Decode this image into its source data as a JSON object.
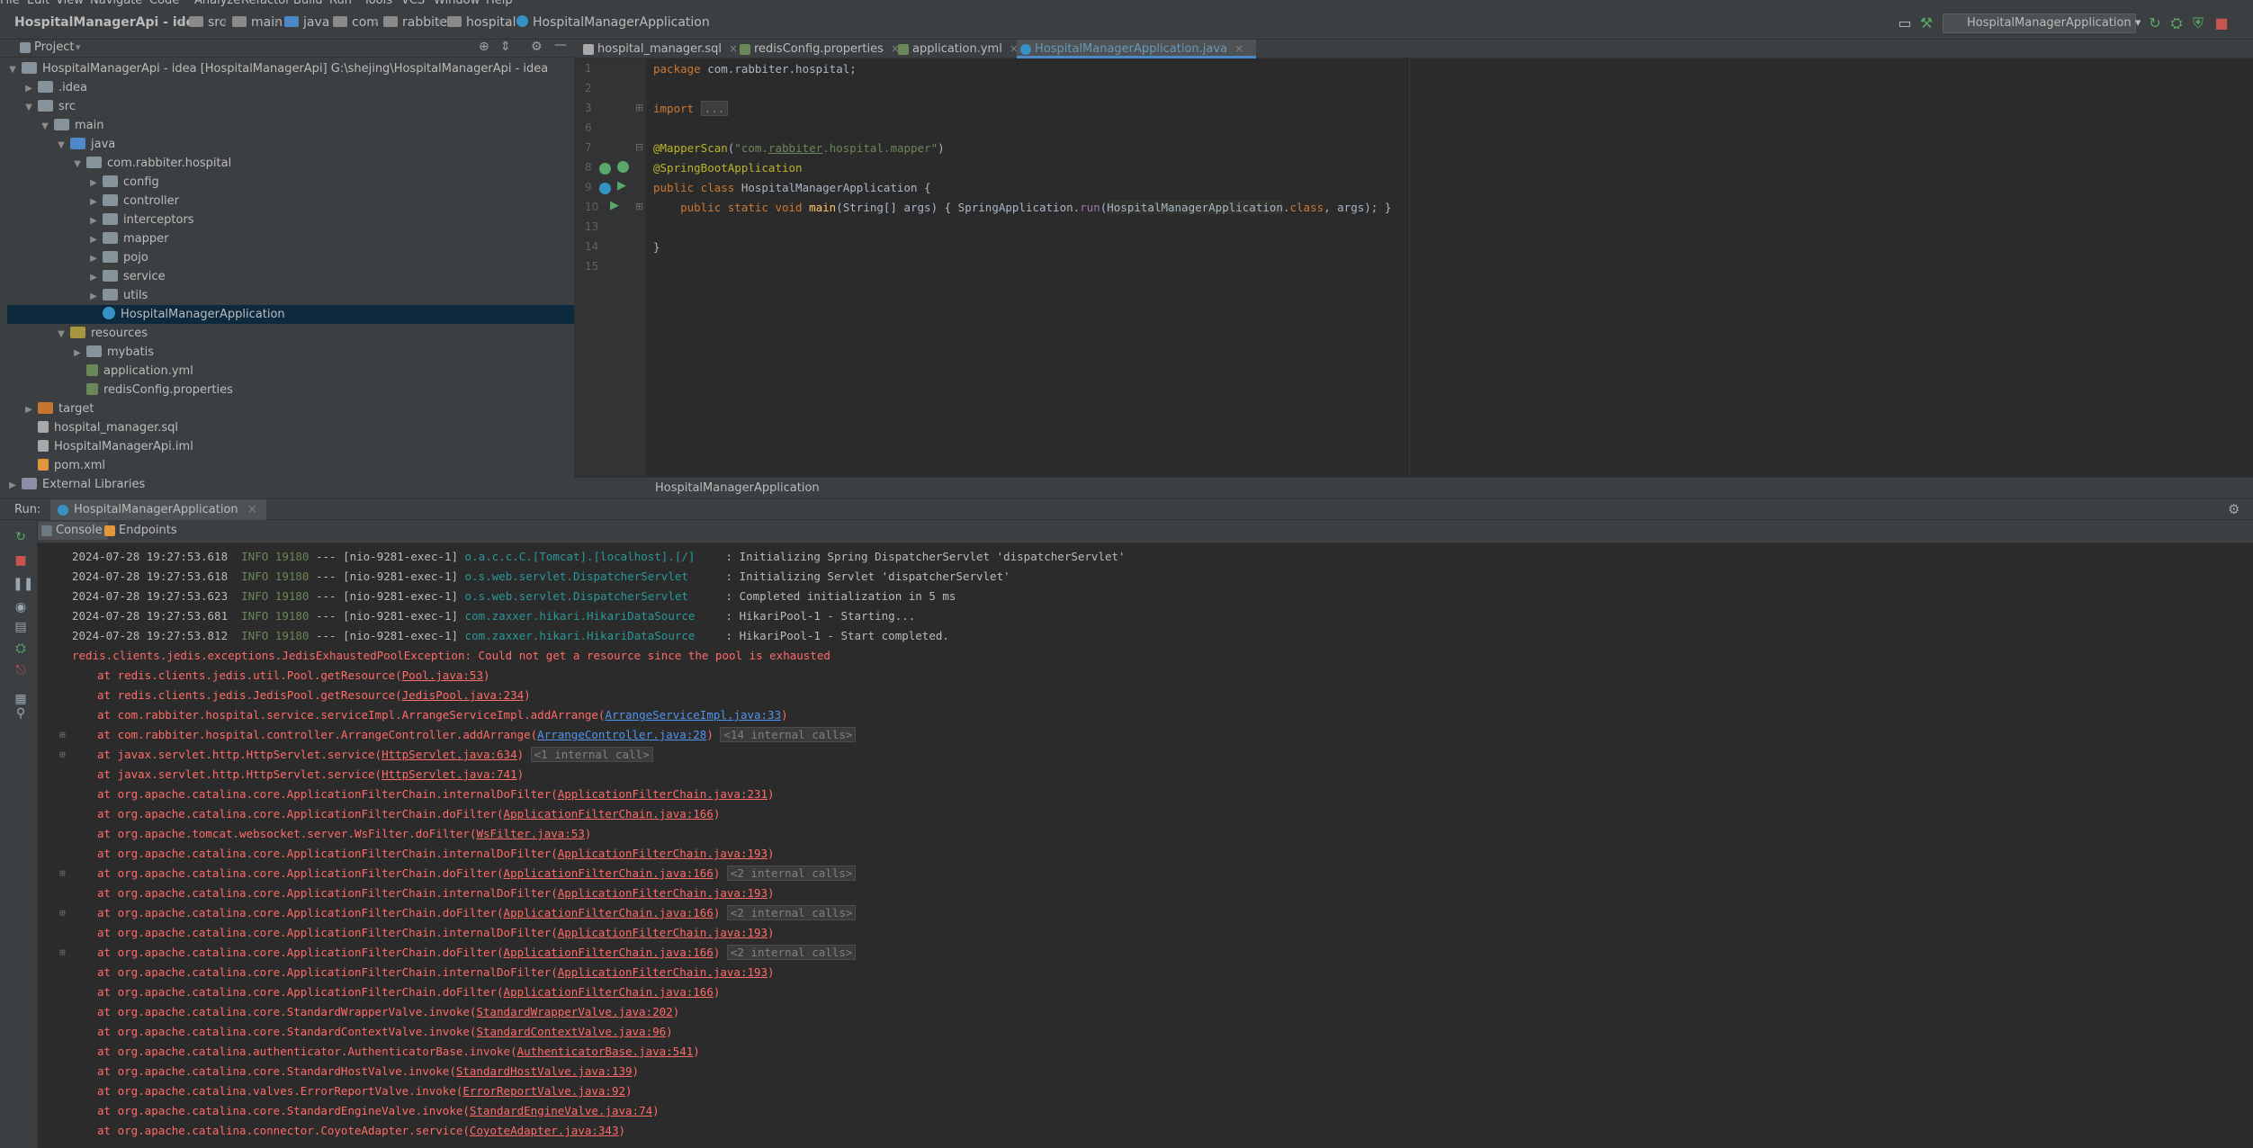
{
  "menu": [
    "File",
    "Edit",
    "View",
    "Navigate",
    "Code",
    "Analyze",
    "Refactor",
    "Build",
    "Run",
    "Tools",
    "VCS",
    "Window",
    "Help"
  ],
  "breadcrumbs": [
    "HospitalManagerApi - idea",
    "src",
    "main",
    "java",
    "com",
    "rabbiter",
    "hospital",
    "HospitalManagerApplication"
  ],
  "run_config": "HospitalManagerApplication",
  "project_panel": {
    "title": "Project",
    "tree": [
      {
        "label": "HospitalManagerApi - idea [HospitalManagerApi] G:\\shejing\\HospitalManagerApi - idea",
        "depth": 0,
        "expanded": true,
        "icon": "module"
      },
      {
        "label": ".idea",
        "depth": 1,
        "expanded": false,
        "icon": "folder"
      },
      {
        "label": "src",
        "depth": 1,
        "expanded": true,
        "icon": "folder"
      },
      {
        "label": "main",
        "depth": 2,
        "expanded": true,
        "icon": "folder"
      },
      {
        "label": "java",
        "depth": 3,
        "expanded": true,
        "icon": "src"
      },
      {
        "label": "com.rabbiter.hospital",
        "depth": 4,
        "expanded": true,
        "icon": "pkg"
      },
      {
        "label": "config",
        "depth": 5,
        "expanded": false,
        "icon": "pkg"
      },
      {
        "label": "controller",
        "depth": 5,
        "expanded": false,
        "icon": "pkg"
      },
      {
        "label": "interceptors",
        "depth": 5,
        "expanded": false,
        "icon": "pkg"
      },
      {
        "label": "mapper",
        "depth": 5,
        "expanded": false,
        "icon": "pkg"
      },
      {
        "label": "pojo",
        "depth": 5,
        "expanded": false,
        "icon": "pkg"
      },
      {
        "label": "service",
        "depth": 5,
        "expanded": false,
        "icon": "pkg"
      },
      {
        "label": "utils",
        "depth": 5,
        "expanded": false,
        "icon": "pkg"
      },
      {
        "label": "HospitalManagerApplication",
        "depth": 5,
        "expanded": null,
        "icon": "cls",
        "selected": true
      },
      {
        "label": "resources",
        "depth": 3,
        "expanded": true,
        "icon": "res"
      },
      {
        "label": "mybatis",
        "depth": 4,
        "expanded": false,
        "icon": "folder"
      },
      {
        "label": "application.yml",
        "depth": 4,
        "expanded": null,
        "icon": "file"
      },
      {
        "label": "redisConfig.properties",
        "depth": 4,
        "expanded": null,
        "icon": "file"
      },
      {
        "label": "target",
        "depth": 1,
        "expanded": false,
        "icon": "orange"
      },
      {
        "label": "hospital_manager.sql",
        "depth": 1,
        "expanded": null,
        "icon": "sql"
      },
      {
        "label": "HospitalManagerApi.iml",
        "depth": 1,
        "expanded": null,
        "icon": "sql"
      },
      {
        "label": "pom.xml",
        "depth": 1,
        "expanded": null,
        "icon": "xml"
      },
      {
        "label": "External Libraries",
        "depth": 0,
        "expanded": false,
        "icon": "lib"
      }
    ]
  },
  "editor": {
    "tabs": [
      {
        "label": "hospital_manager.sql",
        "active": false
      },
      {
        "label": "redisConfig.properties",
        "active": false
      },
      {
        "label": "application.yml",
        "active": false
      },
      {
        "label": "HospitalManagerApplication.java",
        "active": true
      }
    ],
    "line_numbers": [
      "1",
      "2",
      "3",
      "6",
      "7",
      "8",
      "9",
      "10",
      "13",
      "14",
      "15"
    ],
    "code": {
      "l1_kw": "package",
      "l1_rest": " com.rabbiter.hospital;",
      "l3_kw": "import",
      "l3_fold": "...",
      "l7_ann": "@MapperScan",
      "l7_a": "(",
      "l7_str1": "\"com.",
      "l7_str2": "rabbiter",
      "l7_str3": ".hospital.mapper\"",
      "l7_b": ")",
      "l8_ann": "@SpringBootApplication",
      "l9_kw": "public class",
      "l9_name": " HospitalManagerApplication",
      "l9_rest": " {",
      "l10_kw": "    public static void",
      "l10_fn": " main",
      "l10_args": "(String[] args)",
      "l10_body1": " { SpringApplication.",
      "l10_call": "run",
      "l10_body2": "(",
      "l10_cls": "HospitalManagerApplication",
      "l10_body3": ".",
      "l10_kw2": "class",
      "l10_body4": ", args); }",
      "l14": "}"
    },
    "breadcrumb": "HospitalManagerApplication"
  },
  "run_panel": {
    "label": "Run:",
    "tab": "HospitalManagerApplication",
    "subtabs": [
      "Console",
      "Endpoints"
    ],
    "log_info": [
      {
        "ts": "2024-07-28 19:27:53.618",
        "lvl": "INFO",
        "pid": "19180",
        "thread": "--- [nio-9281-exec-1]",
        "logger": "o.a.c.c.C.[Tomcat].[localhost].[/]",
        "msg": ": Initializing Spring DispatcherServlet 'dispatcherServlet'"
      },
      {
        "ts": "2024-07-28 19:27:53.618",
        "lvl": "INFO",
        "pid": "19180",
        "thread": "--- [nio-9281-exec-1]",
        "logger": "o.s.web.servlet.DispatcherServlet",
        "msg": ": Initializing Servlet 'dispatcherServlet'"
      },
      {
        "ts": "2024-07-28 19:27:53.623",
        "lvl": "INFO",
        "pid": "19180",
        "thread": "--- [nio-9281-exec-1]",
        "logger": "o.s.web.servlet.DispatcherServlet",
        "msg": ": Completed initialization in 5 ms"
      },
      {
        "ts": "2024-07-28 19:27:53.681",
        "lvl": "INFO",
        "pid": "19180",
        "thread": "--- [nio-9281-exec-1]",
        "logger": "com.zaxxer.hikari.HikariDataSource",
        "msg": ": HikariPool-1 - Starting..."
      },
      {
        "ts": "2024-07-28 19:27:53.812",
        "lvl": "INFO",
        "pid": "19180",
        "thread": "--- [nio-9281-exec-1]",
        "logger": "com.zaxxer.hikari.HikariDataSource",
        "msg": ": HikariPool-1 - Start completed."
      }
    ],
    "exception": "redis.clients.jedis.exceptions.JedisExhaustedPoolException: Could not get a resource since the pool is exhausted",
    "stack": [
      {
        "text": "at redis.clients.jedis.util.Pool.getResource(",
        "link": "Pool.java:53",
        "hint": "",
        "fold": false,
        "blue": false
      },
      {
        "text": "at redis.clients.jedis.JedisPool.getResource(",
        "link": "JedisPool.java:234",
        "hint": "",
        "fold": false,
        "blue": false
      },
      {
        "text": "at com.rabbiter.hospital.service.serviceImpl.ArrangeServiceImpl.addArrange(",
        "link": "ArrangeServiceImpl.java:33",
        "hint": "",
        "fold": false,
        "blue": true
      },
      {
        "text": "at com.rabbiter.hospital.controller.ArrangeController.addArrange(",
        "link": "ArrangeController.java:28",
        "hint": "<14 internal calls>",
        "fold": true,
        "blue": true
      },
      {
        "text": "at javax.servlet.http.HttpServlet.service(",
        "link": "HttpServlet.java:634",
        "hint": "<1 internal call>",
        "fold": true,
        "blue": false
      },
      {
        "text": "at javax.servlet.http.HttpServlet.service(",
        "link": "HttpServlet.java:741",
        "hint": "",
        "fold": false,
        "blue": false
      },
      {
        "text": "at org.apache.catalina.core.ApplicationFilterChain.internalDoFilter(",
        "link": "ApplicationFilterChain.java:231",
        "hint": "",
        "fold": false,
        "blue": false
      },
      {
        "text": "at org.apache.catalina.core.ApplicationFilterChain.doFilter(",
        "link": "ApplicationFilterChain.java:166",
        "hint": "",
        "fold": false,
        "blue": false
      },
      {
        "text": "at org.apache.tomcat.websocket.server.WsFilter.doFilter(",
        "link": "WsFilter.java:53",
        "hint": "",
        "fold": false,
        "blue": false
      },
      {
        "text": "at org.apache.catalina.core.ApplicationFilterChain.internalDoFilter(",
        "link": "ApplicationFilterChain.java:193",
        "hint": "",
        "fold": false,
        "blue": false
      },
      {
        "text": "at org.apache.catalina.core.ApplicationFilterChain.doFilter(",
        "link": "ApplicationFilterChain.java:166",
        "hint": "<2 internal calls>",
        "fold": true,
        "blue": false
      },
      {
        "text": "at org.apache.catalina.core.ApplicationFilterChain.internalDoFilter(",
        "link": "ApplicationFilterChain.java:193",
        "hint": "",
        "fold": false,
        "blue": false
      },
      {
        "text": "at org.apache.catalina.core.ApplicationFilterChain.doFilter(",
        "link": "ApplicationFilterChain.java:166",
        "hint": "<2 internal calls>",
        "fold": true,
        "blue": false
      },
      {
        "text": "at org.apache.catalina.core.ApplicationFilterChain.internalDoFilter(",
        "link": "ApplicationFilterChain.java:193",
        "hint": "",
        "fold": false,
        "blue": false
      },
      {
        "text": "at org.apache.catalina.core.ApplicationFilterChain.doFilter(",
        "link": "ApplicationFilterChain.java:166",
        "hint": "<2 internal calls>",
        "fold": true,
        "blue": false
      },
      {
        "text": "at org.apache.catalina.core.ApplicationFilterChain.internalDoFilter(",
        "link": "ApplicationFilterChain.java:193",
        "hint": "",
        "fold": false,
        "blue": false
      },
      {
        "text": "at org.apache.catalina.core.ApplicationFilterChain.doFilter(",
        "link": "ApplicationFilterChain.java:166",
        "hint": "",
        "fold": false,
        "blue": false
      },
      {
        "text": "at org.apache.catalina.core.StandardWrapperValve.invoke(",
        "link": "StandardWrapperValve.java:202",
        "hint": "",
        "fold": false,
        "blue": false
      },
      {
        "text": "at org.apache.catalina.core.StandardContextValve.invoke(",
        "link": "StandardContextValve.java:96",
        "hint": "",
        "fold": false,
        "blue": false
      },
      {
        "text": "at org.apache.catalina.authenticator.AuthenticatorBase.invoke(",
        "link": "AuthenticatorBase.java:541",
        "hint": "",
        "fold": false,
        "blue": false
      },
      {
        "text": "at org.apache.catalina.core.StandardHostValve.invoke(",
        "link": "StandardHostValve.java:139",
        "hint": "",
        "fold": false,
        "blue": false
      },
      {
        "text": "at org.apache.catalina.valves.ErrorReportValve.invoke(",
        "link": "ErrorReportValve.java:92",
        "hint": "",
        "fold": false,
        "blue": false
      },
      {
        "text": "at org.apache.catalina.core.StandardEngineValve.invoke(",
        "link": "StandardEngineValve.java:74",
        "hint": "",
        "fold": false,
        "blue": false
      },
      {
        "text": "at org.apache.catalina.connector.CoyoteAdapter.service(",
        "link": "CoyoteAdapter.java:343",
        "hint": "",
        "fold": false,
        "blue": false
      }
    ]
  }
}
